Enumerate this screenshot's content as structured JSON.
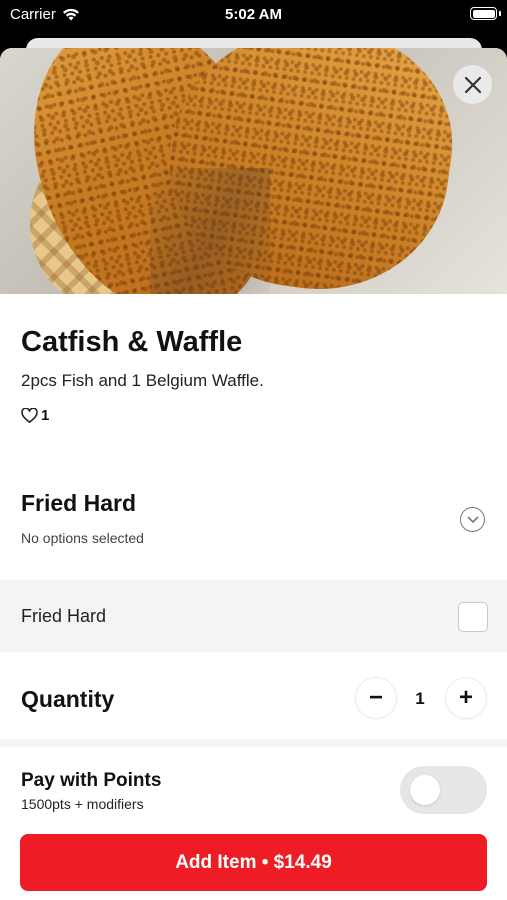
{
  "status_bar": {
    "carrier": "Carrier",
    "time": "5:02 AM"
  },
  "item": {
    "title": "Catfish & Waffle",
    "description": "2pcs Fish and 1 Belgium Waffle.",
    "likes": "1"
  },
  "modifier_group": {
    "title": "Fried Hard",
    "subtitle": "No options selected",
    "options": [
      {
        "label": "Fried Hard",
        "checked": false
      }
    ]
  },
  "quantity": {
    "label": "Quantity",
    "value": "1",
    "minus": "−",
    "plus": "+"
  },
  "points": {
    "title": "Pay with Points",
    "subtitle": "1500pts + modifiers",
    "enabled": false
  },
  "cta": {
    "label": "Add Item • $14.49"
  },
  "colors": {
    "primary": "#ee1c25",
    "option_bg": "#f4f4f4",
    "toggle_off": "#e6e6e6"
  }
}
